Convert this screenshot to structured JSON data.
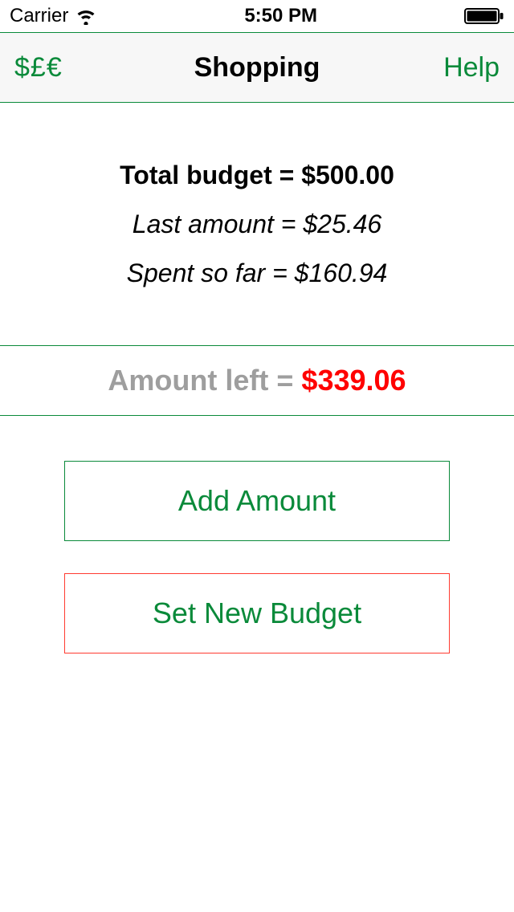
{
  "status": {
    "carrier": "Carrier",
    "time": "5:50 PM"
  },
  "nav": {
    "currency_label": "$£€",
    "title": "Shopping",
    "help_label": "Help"
  },
  "summary": {
    "total_label": "Total budget =  ",
    "total_value": "$500.00",
    "last_label": "Last amount = ",
    "last_value": "$25.46",
    "spent_label": "Spent so far = ",
    "spent_value": "$160.94"
  },
  "remaining": {
    "label": "Amount left =  ",
    "value": "$339.06"
  },
  "buttons": {
    "add": "Add Amount",
    "set": "Set New Budget"
  }
}
